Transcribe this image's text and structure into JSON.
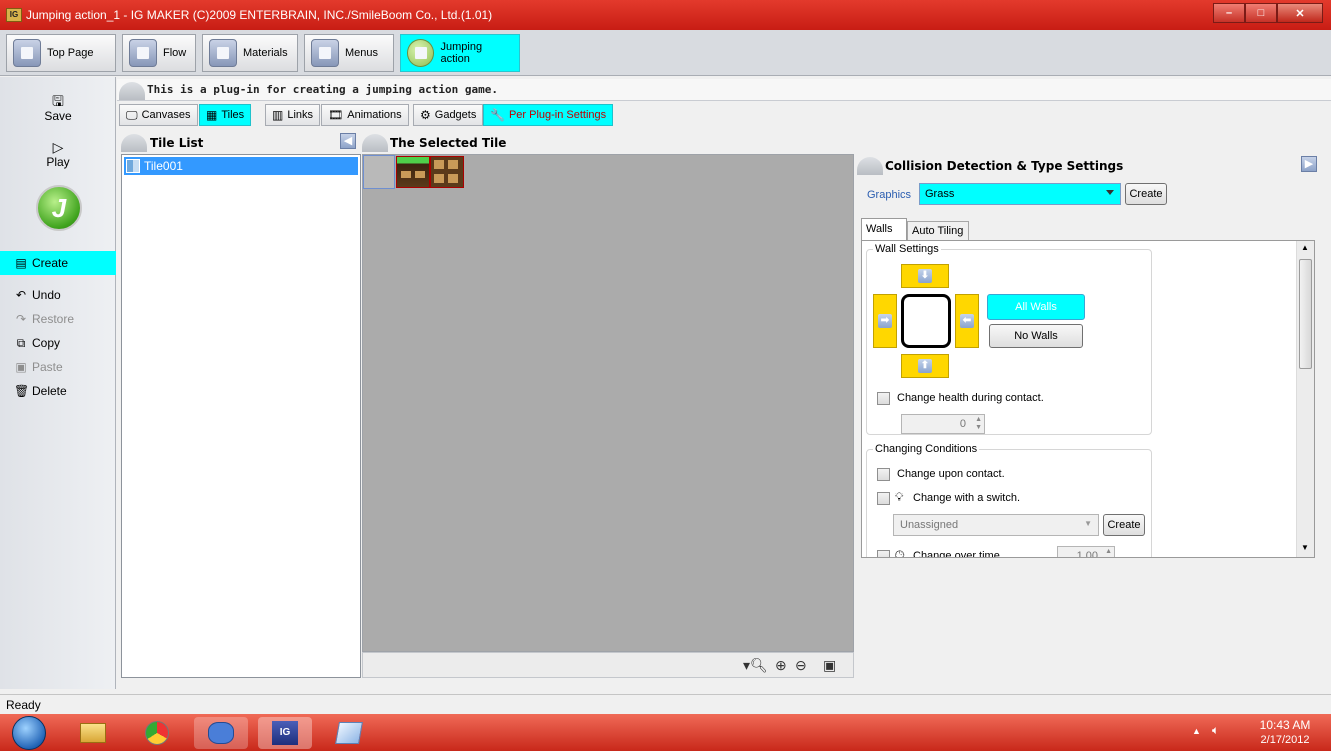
{
  "window": {
    "title": "Jumping action_1 - IG MAKER (C)2009 ENTERBRAIN, INC./SmileBoom Co., Ltd.(1.01)",
    "app_icon_text": "IG",
    "minimize": "–",
    "maximize": "□",
    "close": "✕"
  },
  "topnav": {
    "items": [
      {
        "label": "Top Page"
      },
      {
        "label": "Flow"
      },
      {
        "label": "Materials"
      },
      {
        "label": "Menus"
      },
      {
        "label": "Jumping action"
      }
    ]
  },
  "leftbar": {
    "save": "Save",
    "play": "Play",
    "logo": "J",
    "actions": [
      {
        "label": "Create"
      },
      {
        "label": "Undo"
      },
      {
        "label": "Restore"
      },
      {
        "label": "Copy"
      },
      {
        "label": "Paste"
      },
      {
        "label": "Delete"
      }
    ]
  },
  "description": "This is a plug-in for creating a jumping action game.",
  "tabs": [
    {
      "label": "Canvases"
    },
    {
      "label": "Tiles"
    },
    {
      "label": "Links"
    },
    {
      "label": "Animations"
    },
    {
      "label": "Gadgets"
    },
    {
      "label": "Per Plug-in Settings"
    }
  ],
  "tile_list": {
    "header": "Tile List",
    "items": [
      {
        "label": "Tile001"
      }
    ]
  },
  "selected_tile": {
    "header": "The Selected Tile"
  },
  "collision": {
    "header": "Collision Detection & Type Settings",
    "graphics_label": "Graphics",
    "graphics_value": "Grass",
    "create_button": "Create",
    "subtabs": [
      {
        "label": "Walls"
      },
      {
        "label": "Auto Tiling"
      }
    ],
    "wall_settings": "Wall Settings",
    "all_walls": "All Walls",
    "no_walls": "No Walls",
    "change_health": "Change health during contact.",
    "health_value": "0",
    "changing_conditions": "Changing Conditions",
    "change_contact": "Change upon contact.",
    "change_switch": "Change with a switch.",
    "switch_value": "Unassigned",
    "switch_create": "Create",
    "change_time": "Change over time.",
    "time_value": "1.00"
  },
  "statusbar": {
    "text": "Ready"
  },
  "taskbar": {
    "time": "10:43 AM",
    "date": "2/17/2012"
  },
  "colors": {
    "highlight": "#00ffff",
    "selection": "#3399ff",
    "wall_button": "#ffd700",
    "titlebar": "#d42a1f"
  }
}
